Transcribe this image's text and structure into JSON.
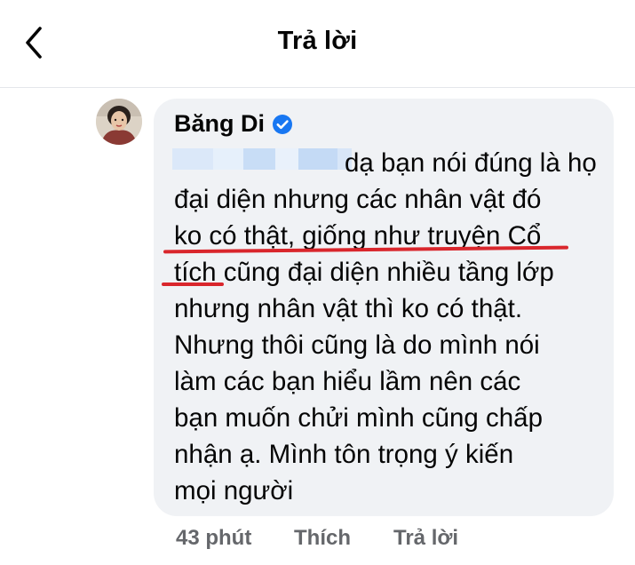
{
  "header": {
    "back_icon": "chevron-left-icon",
    "title": "Trả lời"
  },
  "comment": {
    "author": "Băng Di",
    "verified_icon": "verified-badge-icon",
    "mention_obscured": true,
    "lines": [
      "dạ bạn nói đúng là họ",
      "đại diện nhưng các nhân vật đó",
      "ko có thật, giống như truyện Cổ",
      "tích cũng đại diện nhiều tầng lớp",
      "nhưng nhân vật thì ko có thật.",
      "Nhưng thôi cũng là do mình nói",
      "làm các bạn hiểu lầm nên các",
      "bạn muốn chửi mình cũng chấp",
      "nhận ạ. Mình tôn trọng ý kiến",
      "mọi người"
    ]
  },
  "actions": {
    "time": "43 phút",
    "like": "Thích",
    "reply": "Trả lời"
  },
  "colors": {
    "bubble": "#f0f2f5",
    "underline": "#d9262c",
    "verified": "#1877f2",
    "muted": "#65676b"
  }
}
